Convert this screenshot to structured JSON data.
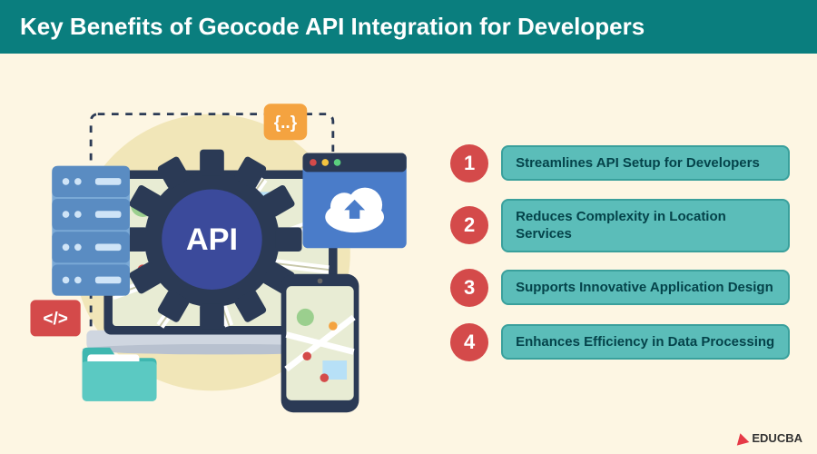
{
  "header": {
    "title": "Key Benefits of Geocode API Integration for Developers"
  },
  "gear": {
    "label": "API"
  },
  "code_tag": {
    "label": "</>"
  },
  "curly_tag": {
    "label": "{..}"
  },
  "benefits": [
    {
      "num": "1",
      "text": "Streamlines API Setup for Developers"
    },
    {
      "num": "2",
      "text": "Reduces Complexity in Location Services"
    },
    {
      "num": "3",
      "text": "Supports Innovative Application Design"
    },
    {
      "num": "4",
      "text": "Enhances Efficiency in Data Processing"
    }
  ],
  "logo": {
    "text": "EDUCBA"
  }
}
